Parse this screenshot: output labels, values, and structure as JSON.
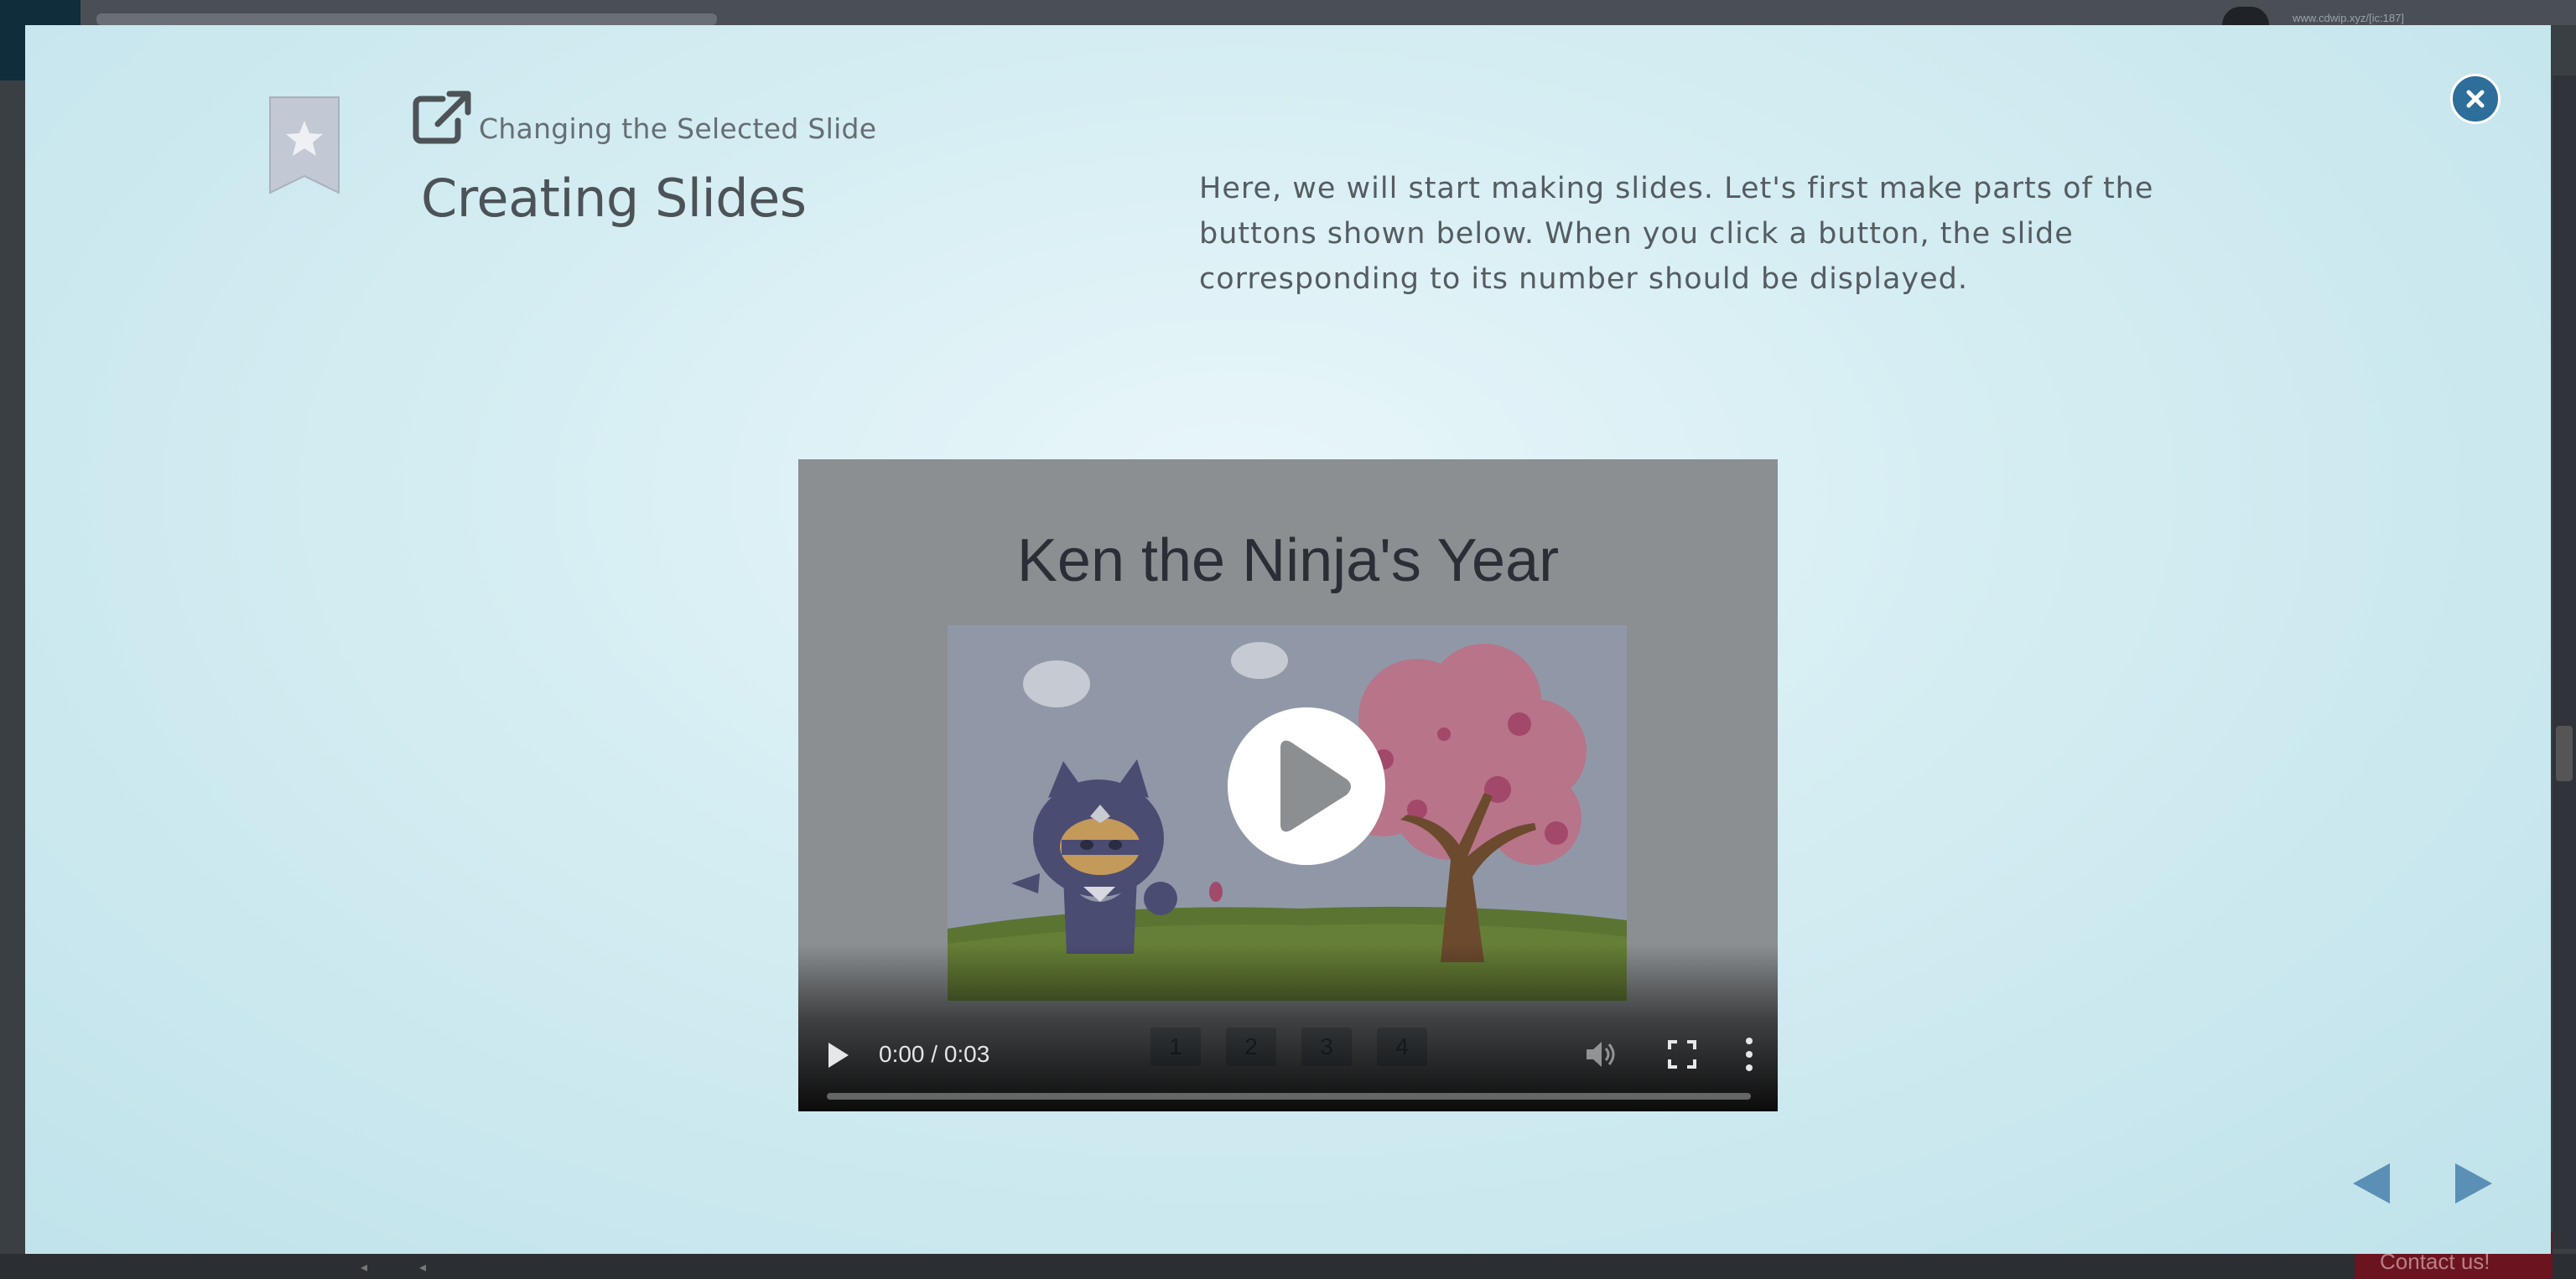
{
  "background": {
    "user_text": "www.cdwip.xyz/[ic:187]",
    "contact_label": "Contact us!"
  },
  "modal": {
    "subtitle": "Changing the Selected Slide",
    "title": "Creating Slides",
    "description": "Here, we will start making slides. Let's first make parts of the buttons shown below. When you click a button, the slide corresponding to its number should be displayed.",
    "icons": {
      "close": "close-icon",
      "bookmark": "bookmark-star-icon",
      "external_link": "external-link-icon",
      "prev": "triangle-left-icon",
      "next": "triangle-right-icon"
    }
  },
  "video": {
    "title": "Ken the Ninja's Year",
    "time": "0:00 / 0:03",
    "progress": 0,
    "slide_buttons": [
      "1",
      "2",
      "3",
      "4"
    ]
  },
  "colors": {
    "accent": "#2d6e9a",
    "nav_arrow": "#5a8fb6",
    "modal_bg": "#d6eef3"
  }
}
